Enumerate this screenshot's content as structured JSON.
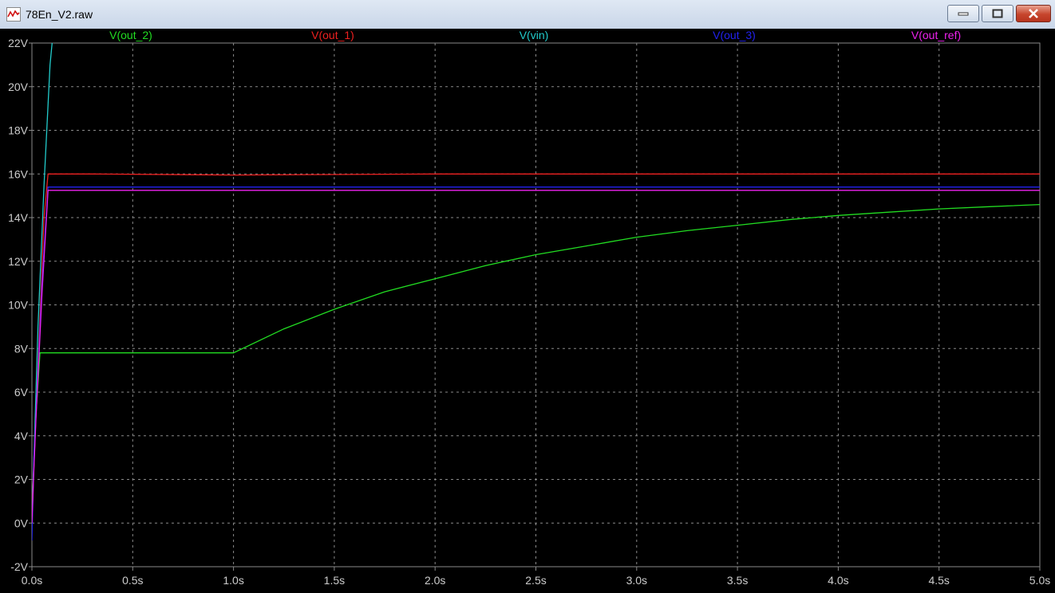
{
  "window": {
    "title": "78En_V2.raw",
    "buttons": {
      "minimize": "minimize",
      "maximize": "maximize",
      "close": "close"
    }
  },
  "colors": {
    "out_2": "#22dd22",
    "out_1": "#ee2020",
    "vin": "#22cccc",
    "out_3": "#2222ee",
    "out_ref": "#ee22ee",
    "grid": "#8a8a8a",
    "axis_text": "#cccccc"
  },
  "chart_data": {
    "type": "line",
    "xlabel": "",
    "ylabel": "",
    "xlim": [
      0,
      5
    ],
    "ylim": [
      -2,
      22
    ],
    "grid": true,
    "legend_placement": "top",
    "x_ticks": [
      "0.0s",
      "0.5s",
      "1.0s",
      "1.5s",
      "2.0s",
      "2.5s",
      "3.0s",
      "3.5s",
      "4.0s",
      "4.5s",
      "5.0s"
    ],
    "y_ticks": [
      "-2V",
      "0V",
      "2V",
      "4V",
      "6V",
      "8V",
      "10V",
      "12V",
      "14V",
      "16V",
      "18V",
      "20V",
      "22V"
    ],
    "series": [
      {
        "name": "V(out_2)",
        "x": [
          0,
          0.02,
          0.04,
          1.0,
          1.25,
          1.5,
          1.75,
          2.0,
          2.25,
          2.5,
          2.75,
          3.0,
          3.25,
          3.5,
          3.75,
          4.0,
          4.25,
          4.5,
          4.75,
          5.0
        ],
        "y": [
          0.3,
          5.0,
          7.8,
          7.8,
          8.9,
          9.8,
          10.6,
          11.2,
          11.8,
          12.3,
          12.7,
          13.1,
          13.4,
          13.65,
          13.9,
          14.1,
          14.25,
          14.4,
          14.5,
          14.6
        ]
      },
      {
        "name": "V(out_1)",
        "x": [
          0,
          0.02,
          0.06,
          0.08,
          0.3,
          1.0,
          2.0,
          3.0,
          4.0,
          5.0
        ],
        "y": [
          0.5,
          5.0,
          14.0,
          16.0,
          16.0,
          15.95,
          16.0,
          16.0,
          16.0,
          16.0
        ]
      },
      {
        "name": "V(vin)",
        "x": [
          0,
          0.01,
          0.03,
          0.06,
          0.09,
          0.1
        ],
        "y": [
          0.0,
          3.0,
          9.0,
          15.5,
          21.0,
          22.0
        ]
      },
      {
        "name": "V(out_3)",
        "x": [
          0,
          0.01,
          0.02,
          0.05,
          0.08,
          1.0,
          2.0,
          3.0,
          4.0,
          5.0
        ],
        "y": [
          -0.8,
          3.0,
          5.0,
          11.0,
          15.4,
          15.4,
          15.4,
          15.4,
          15.4,
          15.4
        ]
      },
      {
        "name": "V(out_ref)",
        "x": [
          0,
          0.01,
          0.02,
          0.05,
          0.08,
          1.0,
          2.0,
          3.0,
          4.0,
          5.0
        ],
        "y": [
          0.0,
          2.5,
          4.8,
          10.5,
          15.25,
          15.25,
          15.25,
          15.25,
          15.25,
          15.25
        ]
      }
    ]
  }
}
